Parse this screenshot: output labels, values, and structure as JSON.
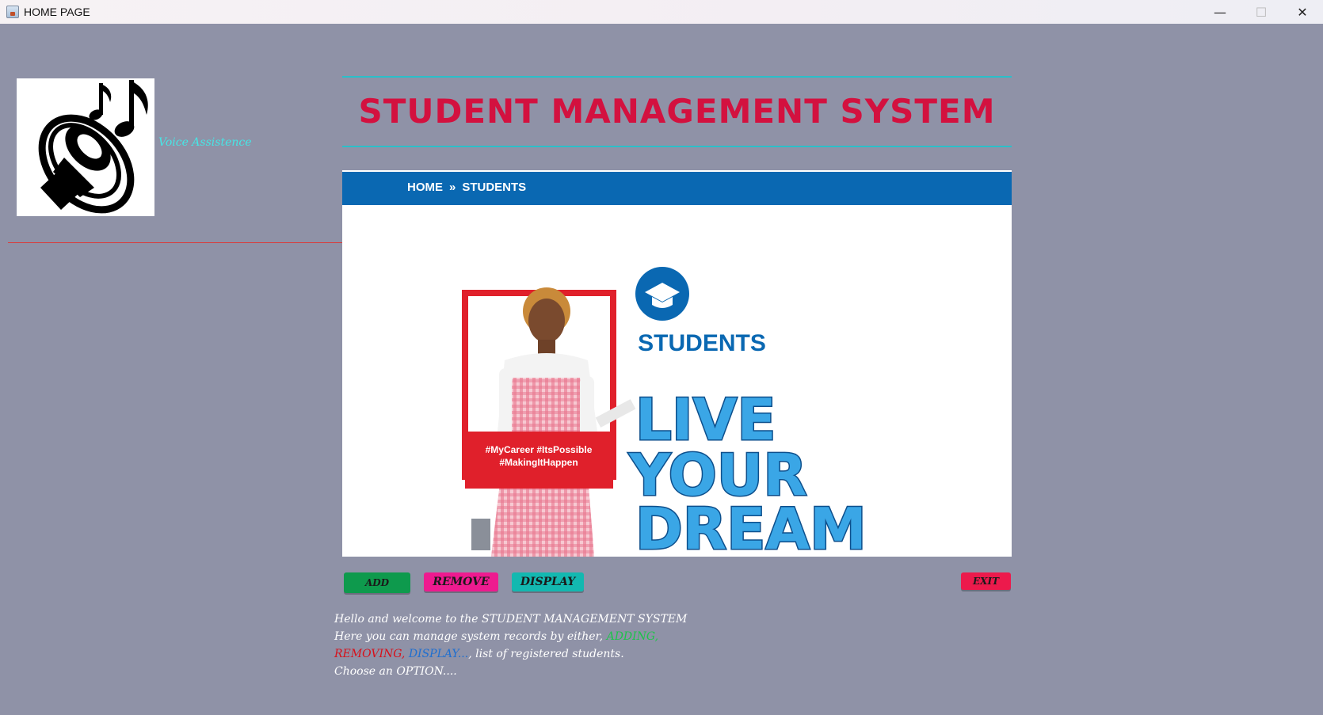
{
  "window": {
    "title": "HOME PAGE",
    "controls": {
      "minimize": "—",
      "maximize": "☐",
      "close": "✕"
    }
  },
  "sidebar": {
    "logo_icon": "speaker-music-note-icon",
    "voice_label": "Voice Assistence"
  },
  "header": {
    "title": "STUDENT MANAGEMENT SYSTEM"
  },
  "banner": {
    "breadcrumb_home": "HOME",
    "breadcrumb_sep": "»",
    "breadcrumb_current": "STUDENTS",
    "badge_label": "STUDENTS",
    "hashtags_line1": "#MyCareer #ItsPossible",
    "hashtags_line2": "#MakingItHappen",
    "slogan_line1": "LIVE",
    "slogan_line2": "YOUR",
    "slogan_line3": "DREAM"
  },
  "actions": {
    "add_label": "ADD",
    "remove_label": "REMOVE",
    "display_label": "DISPLAY",
    "exit_label": "EXIT"
  },
  "welcome": {
    "line1": "Hello and welcome to the STUDENT MANAGEMENT SYSTEM",
    "line2_prefix": "Here you can manage system records by either,",
    "adding": "ADDING,",
    "removing": "REMOVING,",
    "display": "DISPLAY...",
    "line3_suffix": ", list of registered students.",
    "line4": "Choose an OPTION...."
  },
  "colors": {
    "background": "#8f92a7",
    "title_red": "#d3113f",
    "accent_cyan": "#2bbfc9",
    "banner_blue": "#0a68b2",
    "add_green": "#0e9a4d",
    "remove_pink": "#ee1b8f",
    "display_teal": "#13b8b0",
    "exit_red": "#ec1a4c"
  }
}
